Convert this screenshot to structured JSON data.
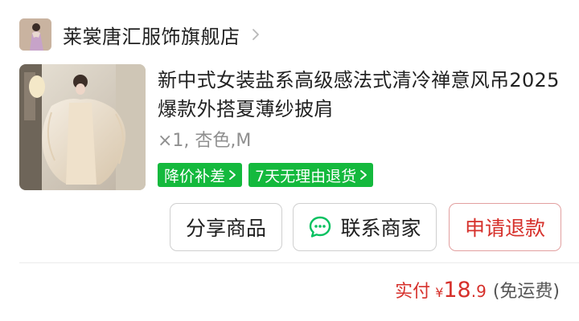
{
  "store": {
    "name": "莱裳唐汇服饰旗舰店"
  },
  "product": {
    "title": "新中式女装盐系高级感法式清冷禅意风吊2025爆款外搭夏薄纱披肩",
    "spec": "×1, 杏色,M",
    "tags": [
      "降价补差",
      "7天无理由退货"
    ]
  },
  "actions": {
    "share_label": "分享商品",
    "contact_label": "联系商家",
    "refund_label": "申请退款"
  },
  "payment": {
    "label": "实付",
    "currency": "¥",
    "amount_int": "18",
    "amount_dec": ".9",
    "shipping_note": "(免运费)"
  },
  "colors": {
    "tag_green": "#14b93d",
    "refund_red": "#d6302b",
    "wechat_green": "#07c160"
  }
}
